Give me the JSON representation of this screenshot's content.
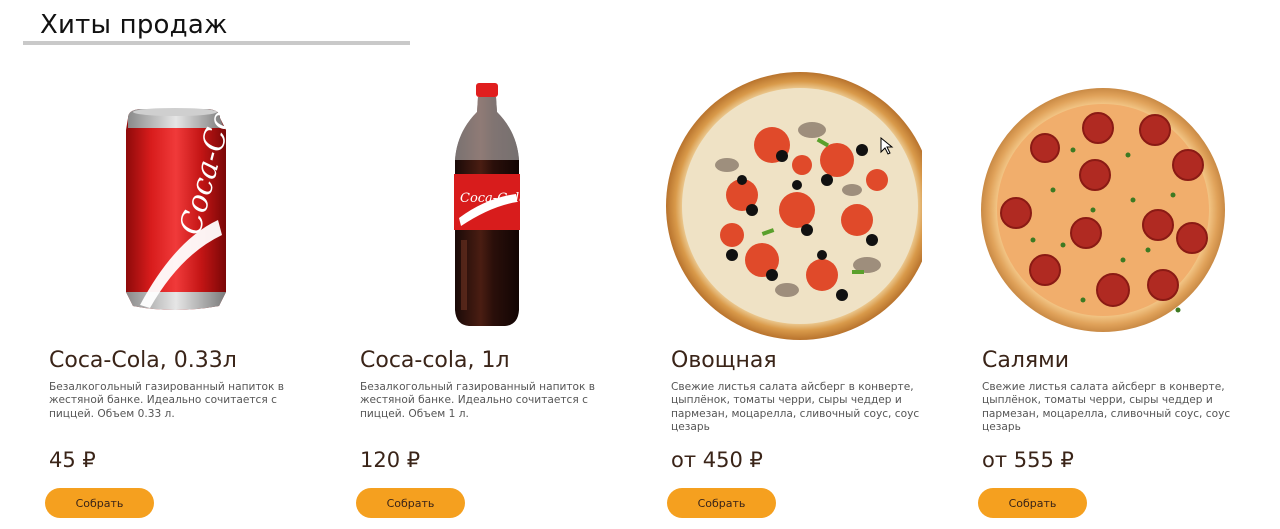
{
  "section": {
    "title": "Хиты продаж"
  },
  "products": [
    {
      "name": "Coca-Cola, 0.33л",
      "description": "Безалкогольный газированный напиток в жестяной банке. Идеально сочитается с пиццей. Объем 0.33 л.",
      "price": "45 ₽",
      "button": "Собрать",
      "image": "coca-cola-can-image"
    },
    {
      "name": "Coca-cola, 1л",
      "description": "Безалкогольный газированный напиток в жестяной банке. Идеально сочитается с пиццей. Объем 1 л.",
      "price": "120 ₽",
      "button": "Собрать",
      "image": "coca-cola-bottle-image"
    },
    {
      "name": "Овощная",
      "description": "Свежие листья салата айсберг в конверте, цыплёнок, томаты черри, сыры чеддер и пармезан, моцарелла, сливочный соус, соус цезарь",
      "price": "от 450 ₽",
      "button": "Собрать",
      "image": "vegetable-pizza-image"
    },
    {
      "name": "Салями",
      "description": "Свежие листья салата айсберг в конверте, цыплёнок, томаты черри, сыры чеддер и пармезан, моцарелла, сливочный соус, соус цезарь",
      "price": "от 555 ₽",
      "button": "Собрать",
      "image": "salami-pizza-image"
    }
  ],
  "colors": {
    "accent": "#f5a01f",
    "text": "#3a2418",
    "rule": "#c9c9c9"
  }
}
